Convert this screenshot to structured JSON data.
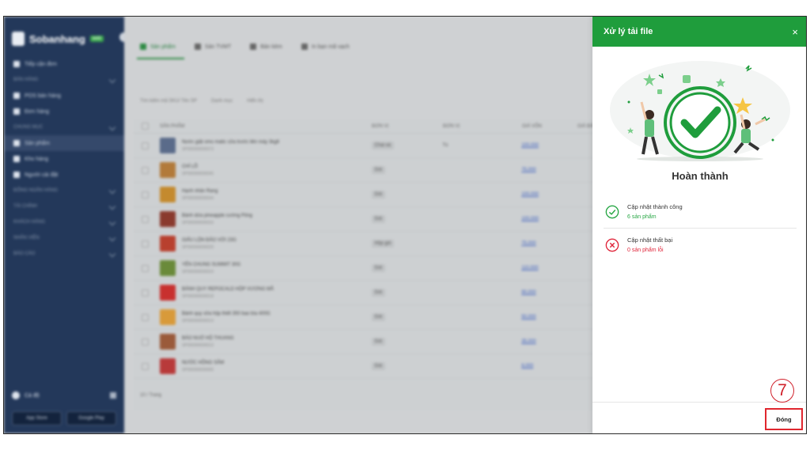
{
  "sidebar": {
    "brand": "Sobanhang",
    "brand_tag": "web",
    "items": [
      {
        "label": "Tiếp cận đơn",
        "type": "item"
      },
      {
        "label": "BÁN HÀNG",
        "type": "section"
      },
      {
        "label": "POS bán hàng",
        "type": "item"
      },
      {
        "label": "Đơn hàng",
        "type": "item"
      },
      {
        "label": "CHUNG MỤC",
        "type": "section"
      },
      {
        "label": "Sản phẩm",
        "type": "item",
        "active": true
      },
      {
        "label": "Kho hàng",
        "type": "item"
      },
      {
        "label": "Người cài đặt",
        "type": "item"
      },
      {
        "label": "ĐỐNG NGÂN HÀNG",
        "type": "section"
      },
      {
        "label": "TÀI CHÍNH",
        "type": "section"
      },
      {
        "label": "KHÁCH HÀNG",
        "type": "section"
      },
      {
        "label": "NHÂN VIÊN",
        "type": "section"
      },
      {
        "label": "BÁO CÁO",
        "type": "section"
      }
    ],
    "user": "Cá độ",
    "store_buttons": [
      "App Store",
      "Google Play"
    ]
  },
  "main": {
    "tabs": [
      "Sản phẩm",
      "Sản TVMT",
      "Bán kèm",
      "In bạn mã vạch"
    ],
    "filters": [
      "Tìm kiếm mã SKU/ Tên SP",
      "Danh mục",
      "Hiển thị"
    ],
    "columns": [
      "SẢN PHẨM",
      "ĐƠN VỊ",
      "ĐƠN VỊ",
      "GIÁ VỐN",
      "GIÁ BÁN"
    ],
    "rows": [
      {
        "name": "Nước giặt omo matic cửa trước liên máy 3kg8",
        "sku": "SP000000000073",
        "unit": "Chai xá",
        "unit2": "Tú",
        "price": "100,000",
        "color": "#5a6b8a"
      },
      {
        "name": "CHÍ LỖ",
        "sku": "SP000000000045",
        "unit": "Gói",
        "unit2": "",
        "price": "75,000",
        "color": "#b27a3a"
      },
      {
        "name": "Hạnh nhân Rang",
        "sku": "SP000000000044",
        "unit": "Gói",
        "unit2": "",
        "price": "100,000",
        "color": "#c48a2e"
      },
      {
        "name": "Bánh dứa pineapple cường Pông",
        "sku": "SP000000000033",
        "unit": "Gói",
        "unit2": "",
        "price": "100,000",
        "color": "#8a3a2e"
      },
      {
        "name": "GIẤU LỘN ĐẢO VỚI 23G",
        "sku": "SP000000000029",
        "unit": "Hộp gói",
        "unit2": "",
        "price": "75,000",
        "color": "#b8402e"
      },
      {
        "name": "YẾN CHUNG SUMMIT 30G",
        "sku": "SP000000000024",
        "unit": "Gói",
        "unit2": "",
        "price": "110,000",
        "color": "#6a8a3a"
      },
      {
        "name": "BÁNH QUY REPOCALD HỘP VƯƠNG MẪ",
        "sku": "SP000000000018",
        "unit": "Gói",
        "unit2": "",
        "price": "90,000",
        "color": "#c8302e"
      },
      {
        "name": "Bánh quy sữa hộp thiết 350 bao bìa 400G",
        "sku": "SP000000000014",
        "unit": "Gói",
        "unit2": "",
        "price": "50,000",
        "color": "#d89a3a"
      },
      {
        "name": "BÁO NUỚ HỘ THUANG",
        "sku": "SP000000000010",
        "unit": "Gói",
        "unit2": "",
        "price": "35,000",
        "color": "#9a5a3a"
      },
      {
        "name": "NƯỚC HỒNG SÂM",
        "sku": "SP000000000006",
        "unit": "Gói",
        "unit2": "",
        "price": "8,000",
        "color": "#b83a3a"
      }
    ],
    "pager": "10 / Trang"
  },
  "panel": {
    "title": "Xử lý tải file",
    "close_icon": "×",
    "done_title": "Hoàn thành",
    "success": {
      "label": "Cập nhật thành công",
      "sub": "6 sản phẩm"
    },
    "failure": {
      "label": "Cập nhật thất bại",
      "sub": "0 sản phẩm lỗi"
    },
    "close_button": "Đóng",
    "step_number": "7"
  },
  "colors": {
    "accent": "#1f9d3c",
    "success": "#28a745",
    "error": "#e0263b",
    "annotation": "#d0202a",
    "sidebar": "#23385a"
  }
}
